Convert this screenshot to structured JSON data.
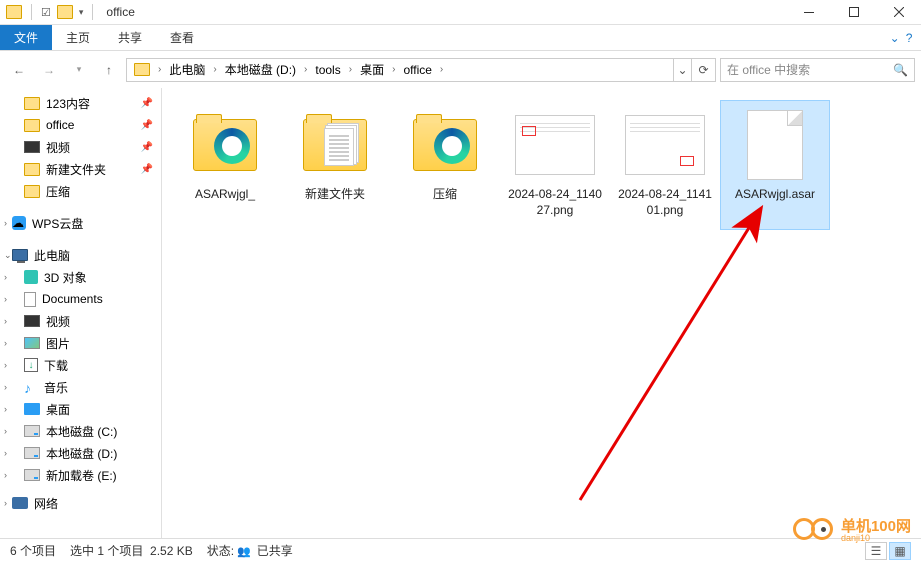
{
  "window": {
    "title": "office"
  },
  "ribbon": {
    "file": "文件",
    "home": "主页",
    "share": "共享",
    "view": "查看"
  },
  "nav": {
    "crumbs": [
      "此电脑",
      "本地磁盘 (D:)",
      "tools",
      "桌面",
      "office"
    ],
    "search_placeholder": "在 office 中搜索"
  },
  "sidebar": {
    "quick": [
      {
        "label": "123内容",
        "pinned": true
      },
      {
        "label": "office",
        "pinned": true
      },
      {
        "label": "视频",
        "pinned": true
      },
      {
        "label": "新建文件夹",
        "pinned": true
      },
      {
        "label": "压缩"
      }
    ],
    "wps": "WPS云盘",
    "pc": "此电脑",
    "pc_items": [
      {
        "label": "3D 对象",
        "icon": "3d"
      },
      {
        "label": "Documents",
        "icon": "doc"
      },
      {
        "label": "视频",
        "icon": "vid"
      },
      {
        "label": "图片",
        "icon": "img"
      },
      {
        "label": "下载",
        "icon": "dl"
      },
      {
        "label": "音乐",
        "icon": "music"
      },
      {
        "label": "桌面",
        "icon": "desk"
      },
      {
        "label": "本地磁盘 (C:)",
        "icon": "drive"
      },
      {
        "label": "本地磁盘 (D:)",
        "icon": "drive"
      },
      {
        "label": "新加载卷 (E:)",
        "icon": "drive"
      }
    ],
    "network": "网络"
  },
  "files": [
    {
      "name": "ASARwjgl_",
      "type": "folder-edge"
    },
    {
      "name": "新建文件夹",
      "type": "folder-docs"
    },
    {
      "name": "压缩",
      "type": "folder-edge"
    },
    {
      "name": "2024-08-24_114027.png",
      "type": "png1"
    },
    {
      "name": "2024-08-24_114101.png",
      "type": "png2"
    },
    {
      "name": "ASARwjgl.asar",
      "type": "blank",
      "selected": true
    }
  ],
  "status": {
    "count": "6 个项目",
    "selected": "选中 1 个项目",
    "size": "2.52 KB",
    "state_label": "状态:",
    "shared": "已共享"
  },
  "watermark": {
    "cn": "单机100网",
    "en": "danji10"
  }
}
